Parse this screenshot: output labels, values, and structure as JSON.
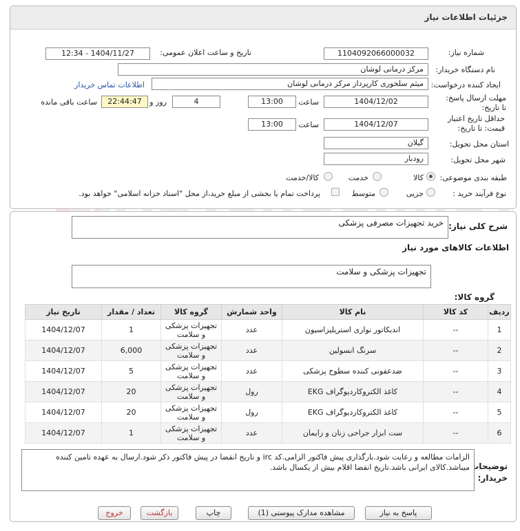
{
  "header": {
    "title": "جزئیات اطلاعات نیاز"
  },
  "fields": {
    "need_number_label": "شماره نیاز:",
    "need_number": "1104092066000032",
    "announce_label": "تاریخ و ساعت اعلان عمومی:",
    "announce_value": "1404/11/27 - 12:34",
    "buyer_org_label": "نام دستگاه خریدار:",
    "buyer_org": "مرکز درمانی لوشان",
    "requester_label": "ایجاد کننده درخواست:",
    "requester": "میثم سلخوری کارپرداز مرکز درمانی لوشان",
    "contact_link": "اطلاعات تماس خریدار",
    "deadline_label": "مهلت ارسال پاسخ: تا تاریخ:",
    "deadline_date": "1404/12/02",
    "time_label": "ساعت",
    "deadline_time": "13:00",
    "days_value": "4",
    "days_label": "روز و",
    "remaining_time": "22:44:47",
    "remaining_label": "ساعت باقی مانده",
    "validity_label": "حداقل تاریخ اعتبار قیمت: تا تاریخ:",
    "validity_date": "1404/12/07",
    "validity_time": "13:00",
    "province_label": "استان محل تحویل:",
    "province": "گیلان",
    "city_label": "شهر محل تحویل:",
    "city": "رودبار",
    "category_label": "طبقه بندی موضوعی:",
    "category_options": [
      "کالا",
      "خدمت",
      "کالا/خدمت"
    ],
    "process_label": "نوع فرآیند خرید :",
    "process_options": [
      "جزیی",
      "متوسط"
    ],
    "treasury_note": "پرداخت تمام یا بخشی از مبلغ خرید،از محل \"اسناد خزانه اسلامی\" خواهد بود."
  },
  "need_desc": {
    "label": "شرح کلی نیاز:",
    "value": "خرید تجهیزات مصرفی پزشکی"
  },
  "goods_info_title": "اطلاعات کالاهای مورد نیاز",
  "goods_group": {
    "label": "گروه کالا:",
    "value": "تجهیزات پزشکی و سلامت"
  },
  "table": {
    "headers": [
      "ردیف",
      "کد کالا",
      "نام کالا",
      "واحد شمارش",
      "گروه کالا",
      "تعداد / مقدار",
      "تاریخ نیاز"
    ],
    "rows": [
      [
        "1",
        "--",
        "اندیکاتور نواری استریلیزاسیون",
        "عدد",
        "تجهیزات پزشکی و سلامت",
        "1",
        "1404/12/07"
      ],
      [
        "2",
        "--",
        "سرنگ انسولین",
        "عدد",
        "تجهیزات پزشکی و سلامت",
        "6,000",
        "1404/12/07"
      ],
      [
        "3",
        "--",
        "ضدعفونی کننده سطوح پزشکی",
        "عدد",
        "تجهیزات پزشکی و سلامت",
        "5",
        "1404/12/07"
      ],
      [
        "4",
        "--",
        "کاغذ الکتروکاردیوگراف EKG",
        "رول",
        "تجهیزات پزشکی و سلامت",
        "20",
        "1404/12/07"
      ],
      [
        "5",
        "--",
        "کاغذ الکتروکاردیوگراف EKG",
        "رول",
        "تجهیزات پزشکی و سلامت",
        "20",
        "1404/12/07"
      ],
      [
        "6",
        "--",
        "ست ابزار جراحی زنان و زایمان",
        "عدد",
        "تجهیزات پزشکی و سلامت",
        "1",
        "1404/12/07"
      ]
    ]
  },
  "buyer_notes": {
    "label": "توضیحات خریدار:",
    "value": "الزامات مطالعه و رعایت شود.بارگذاری پیش فاکتور الزامی.کد irc و تاریخ انقضا در پیش فاکتور ذکر شود.ارسال به عهده تامین کننده میباشد.کالای ایرانی باشد.تاریخ انقضا اقلام بیش از یکسال باشد."
  },
  "buttons": {
    "reply": "پاسخ به نیاز",
    "attachments": "مشاهده مدارک پیوستی (1)",
    "print": "چاپ",
    "back": "بازگشت",
    "exit": "خروج"
  },
  "watermark": "AriaTender.neT",
  "colors": {
    "accent_link": "#2255aa",
    "back_text": "#c03030",
    "exit_text": "#c03030",
    "remaining_bg": "#fff8c6"
  }
}
